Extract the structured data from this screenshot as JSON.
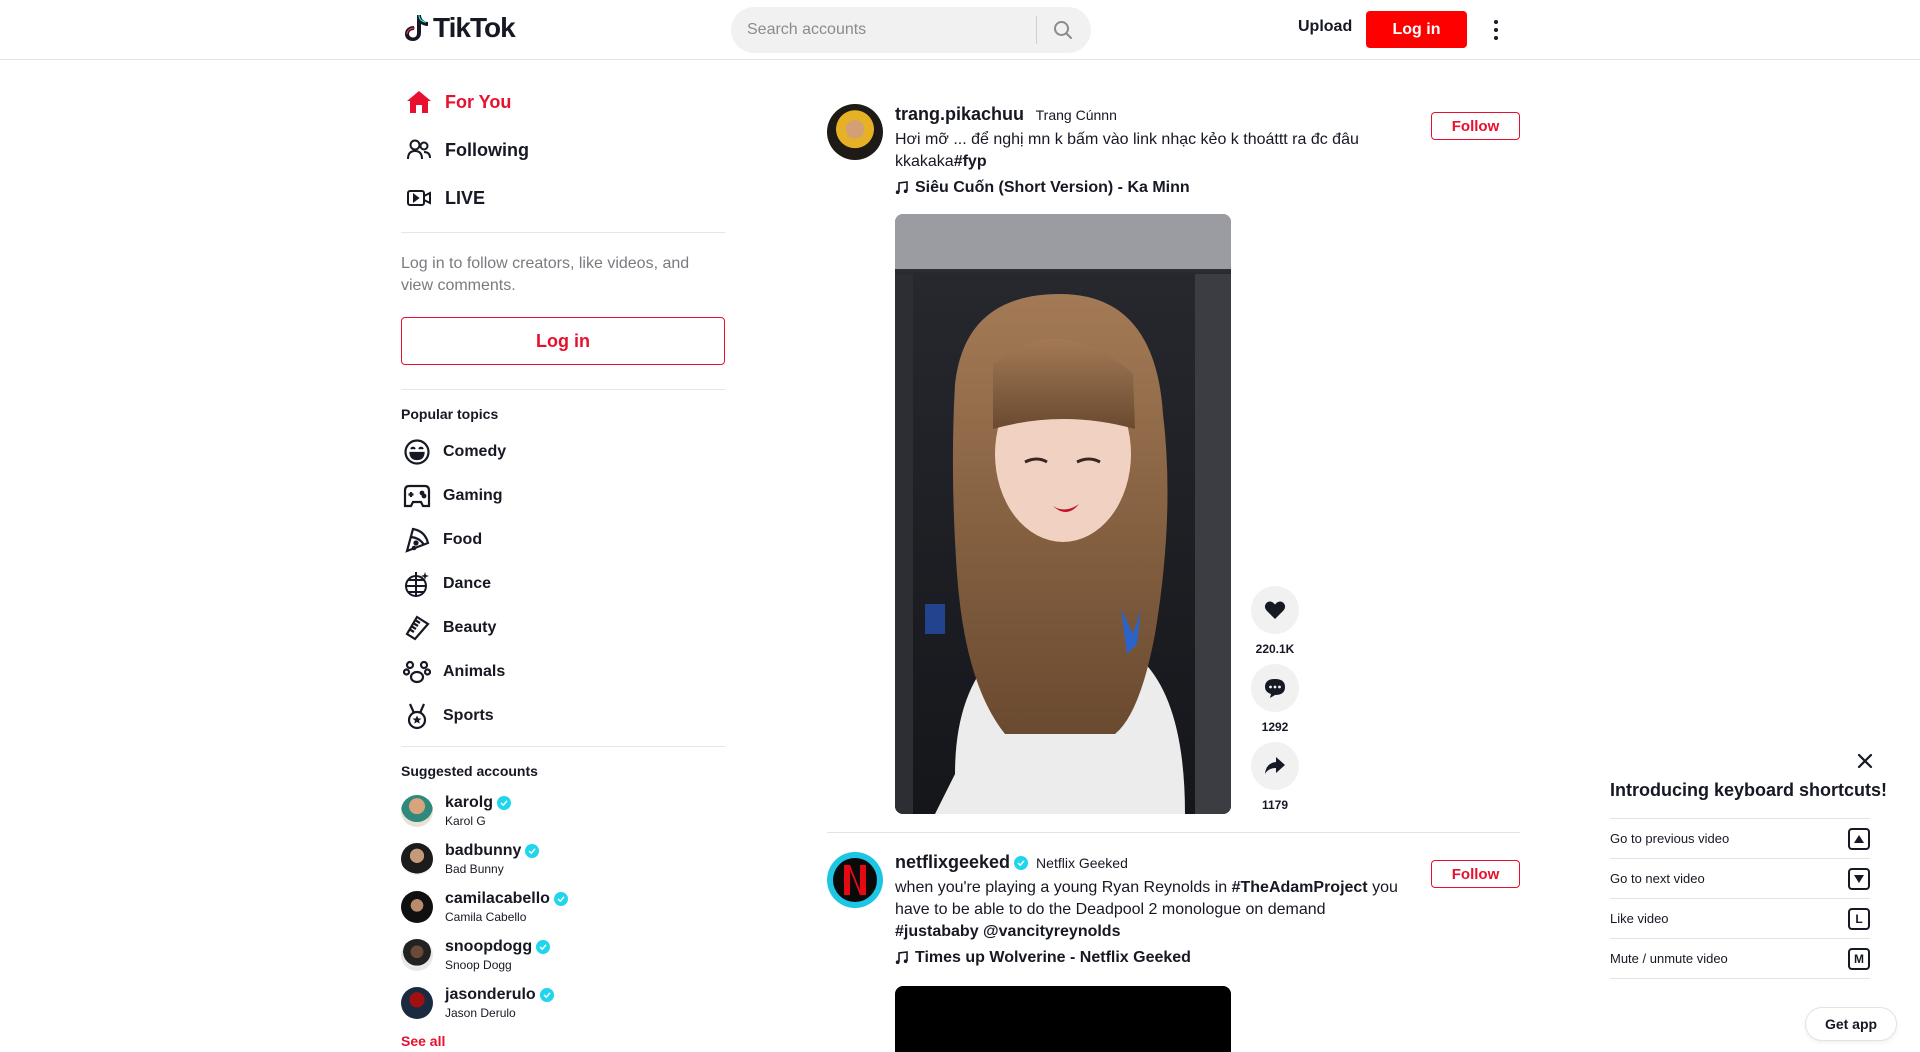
{
  "header": {
    "logo_text": "TikTok",
    "search_placeholder": "Search accounts",
    "upload_label": "Upload",
    "login_label": "Log in"
  },
  "sidebar": {
    "nav": [
      {
        "label": "For You",
        "icon": "home-icon",
        "active": true
      },
      {
        "label": "Following",
        "icon": "users-icon",
        "active": false
      },
      {
        "label": "LIVE",
        "icon": "live-icon",
        "active": false
      }
    ],
    "login_prompt": "Log in to follow creators, like videos, and view comments.",
    "login_button": "Log in",
    "topics_title": "Popular topics",
    "topics": [
      {
        "label": "Comedy",
        "icon": "smile-icon"
      },
      {
        "label": "Gaming",
        "icon": "gamepad-icon"
      },
      {
        "label": "Food",
        "icon": "pizza-icon"
      },
      {
        "label": "Dance",
        "icon": "disco-ball-icon"
      },
      {
        "label": "Beauty",
        "icon": "comb-icon"
      },
      {
        "label": "Animals",
        "icon": "paw-icon"
      },
      {
        "label": "Sports",
        "icon": "medal-icon"
      }
    ],
    "suggested_title": "Suggested accounts",
    "accounts": [
      {
        "username": "karolg",
        "name": "Karol G"
      },
      {
        "username": "badbunny",
        "name": "Bad Bunny"
      },
      {
        "username": "camilacabello",
        "name": "Camila Cabello"
      },
      {
        "username": "snoopdogg",
        "name": "Snoop Dogg"
      },
      {
        "username": "jasonderulo",
        "name": "Jason Derulo"
      }
    ],
    "see_all": "See all"
  },
  "posts": [
    {
      "username": "trang.pikachuu",
      "display_name": "󠁧󠁢󠁳󠁣󠁴 Trang Cúnnn 󠁧",
      "caption_text": "Hơi mỡ 󠁧󠁢󠁳... để nghị mn k bấm vào link nhạc kẻo k thoáttt ra đc đâu kkakaka",
      "caption_tag": "#fyp",
      "music": "Siêu Cuốn (Short Version) - Ka Minn",
      "follow_label": "Follow",
      "likes": "220.1K",
      "comments": "1292",
      "shares": "1179"
    },
    {
      "username": "netflixgeeked",
      "display_name": "Netflix Geeked",
      "caption_text": "when you're playing a young Ryan Reynolds in ",
      "caption_tag1": "#TheAdamProject",
      "caption_text2": " you have to be able to do the Deadpool 2 monologue on demand ",
      "caption_tag2": "#justababy",
      "caption_tag3": "@vancityreynolds",
      "music": "Times up Wolverine - Netflix Geeked",
      "follow_label": "Follow"
    }
  ],
  "shortcuts": {
    "title": "Introducing keyboard shortcuts!",
    "items": [
      {
        "label": "Go to previous video",
        "key": "▲"
      },
      {
        "label": "Go to next video",
        "key": "▼"
      },
      {
        "label": "Like video",
        "key": "L"
      },
      {
        "label": "Mute / unmute video",
        "key": "M"
      }
    ]
  },
  "get_app": "Get app",
  "colors": {
    "brand_red": "#e8102e",
    "verified": "#20d5ec"
  }
}
